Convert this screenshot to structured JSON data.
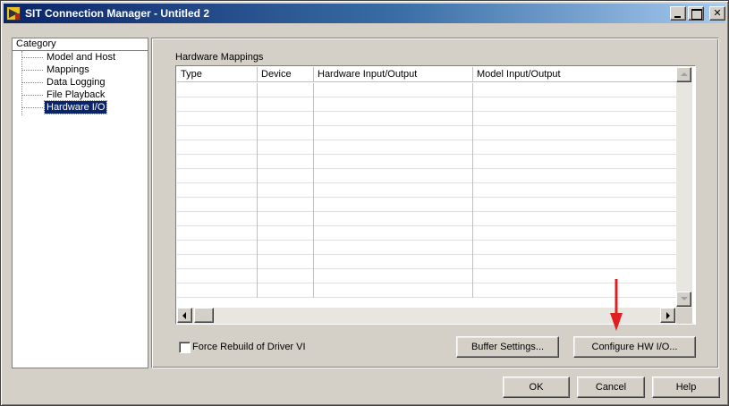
{
  "window": {
    "title": "SIT Connection Manager - Untitled 2"
  },
  "icons": {
    "app": "labview-app-icon",
    "minimize": "minimize-icon",
    "maximize": "maximize-icon",
    "close": "close-icon",
    "annotation": "red-arrow-icon"
  },
  "colors": {
    "titlebar_start": "#0a246a",
    "titlebar_end": "#a6caf0",
    "selection": "#0a246a",
    "annotation_arrow": "#e02020",
    "window_bg": "#d4d0c8"
  },
  "titlebar": {
    "close_glyph": "✕"
  },
  "category": {
    "header": "Category",
    "items": [
      {
        "label": "Model and Host",
        "selected": false
      },
      {
        "label": "Mappings",
        "selected": false
      },
      {
        "label": "Data Logging",
        "selected": false
      },
      {
        "label": "File Playback",
        "selected": false
      },
      {
        "label": "Hardware I/O",
        "selected": true
      }
    ]
  },
  "hardware_mappings": {
    "title": "Hardware Mappings",
    "columns": [
      "Type",
      "Device",
      "Hardware Input/Output",
      "Model Input/Output"
    ],
    "rows": []
  },
  "options": {
    "force_rebuild_label": "Force Rebuild of Driver VI",
    "force_rebuild_checked": false
  },
  "buttons": {
    "buffer_settings": "Buffer Settings...",
    "configure_hw": "Configure HW I/O...",
    "ok": "OK",
    "cancel": "Cancel",
    "help": "Help"
  }
}
